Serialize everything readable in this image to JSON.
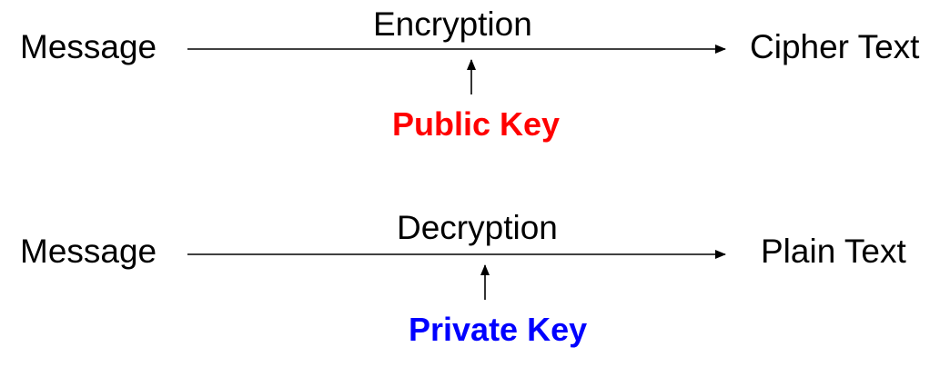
{
  "diagram": {
    "encryption_row": {
      "source_label": "Message",
      "process_label": "Encryption",
      "target_label": "Cipher Text",
      "key_label": "Public Key",
      "key_color": "#ff0000"
    },
    "decryption_row": {
      "source_label": "Message",
      "process_label": "Decryption",
      "target_label": "Plain Text",
      "key_label": "Private Key",
      "key_color": "#0000ff"
    }
  }
}
